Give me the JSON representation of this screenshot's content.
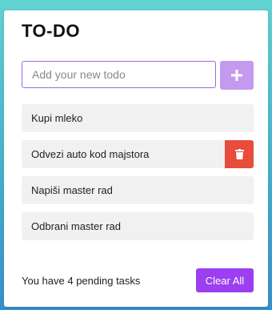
{
  "app": {
    "title": "TO-DO"
  },
  "input": {
    "placeholder": "Add your new todo",
    "value": ""
  },
  "add_button": {
    "icon": "plus-icon",
    "color": "#c39af0"
  },
  "todos": [
    {
      "text": "Kupi mleko"
    },
    {
      "text": "Odvezi auto kod majstora",
      "hovered": true
    },
    {
      "text": "Napiši master rad"
    },
    {
      "text": "Odbrani master rad"
    }
  ],
  "delete_button": {
    "icon": "trash-icon",
    "color": "#e74c3c"
  },
  "footer": {
    "pending_text": "You have 4 pending tasks",
    "clear_label": "Clear All",
    "clear_color": "#9b3ff0"
  }
}
